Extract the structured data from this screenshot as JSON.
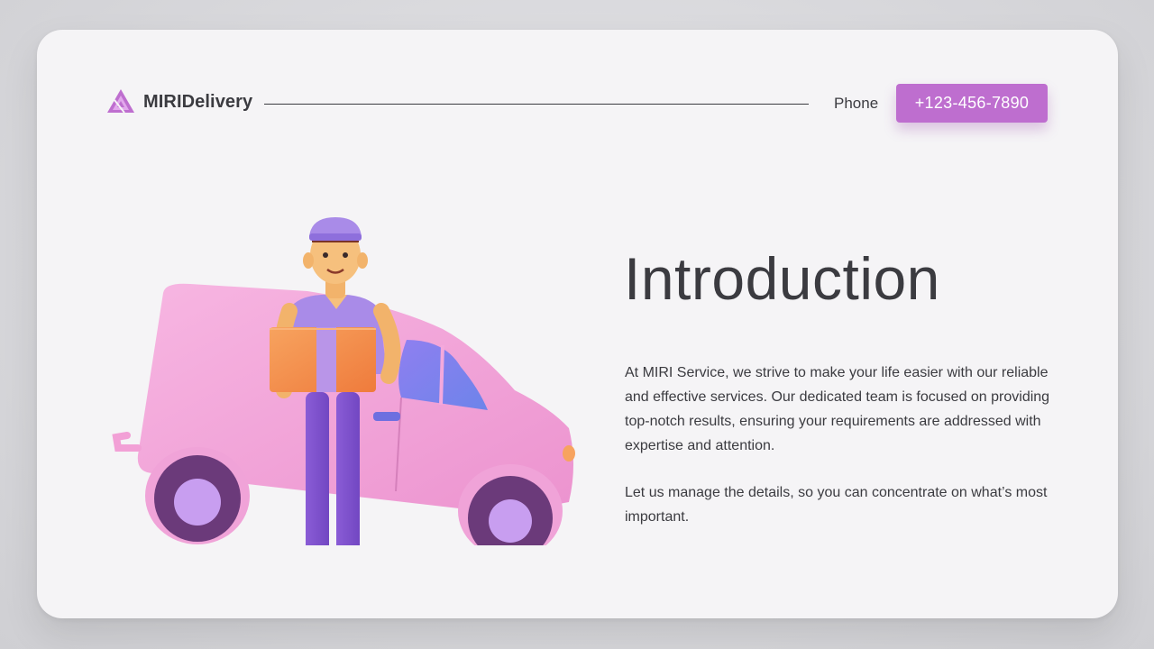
{
  "header": {
    "brand_name": "MIRIDelivery",
    "logo_icon": "triangle-logo-icon",
    "phone_label": "Phone",
    "phone_number": "+123-456-7890"
  },
  "content": {
    "title": "Introduction",
    "paragraph_1": "At MIRI Service, we strive to make your life easier with our reliable and effective services. Our dedicated team is focused on providing top-notch results, ensuring your requirements are addressed with expertise and attention.",
    "paragraph_2": "Let us manage the details, so you can concentrate on what’s most important."
  },
  "illustration": {
    "subject": "delivery-man-with-van"
  },
  "colors": {
    "accent": "#be6ecf",
    "text": "#3b3b40",
    "card_background": "#f5f4f6",
    "van": "#f3a6d8",
    "box": "#f48a4a"
  }
}
